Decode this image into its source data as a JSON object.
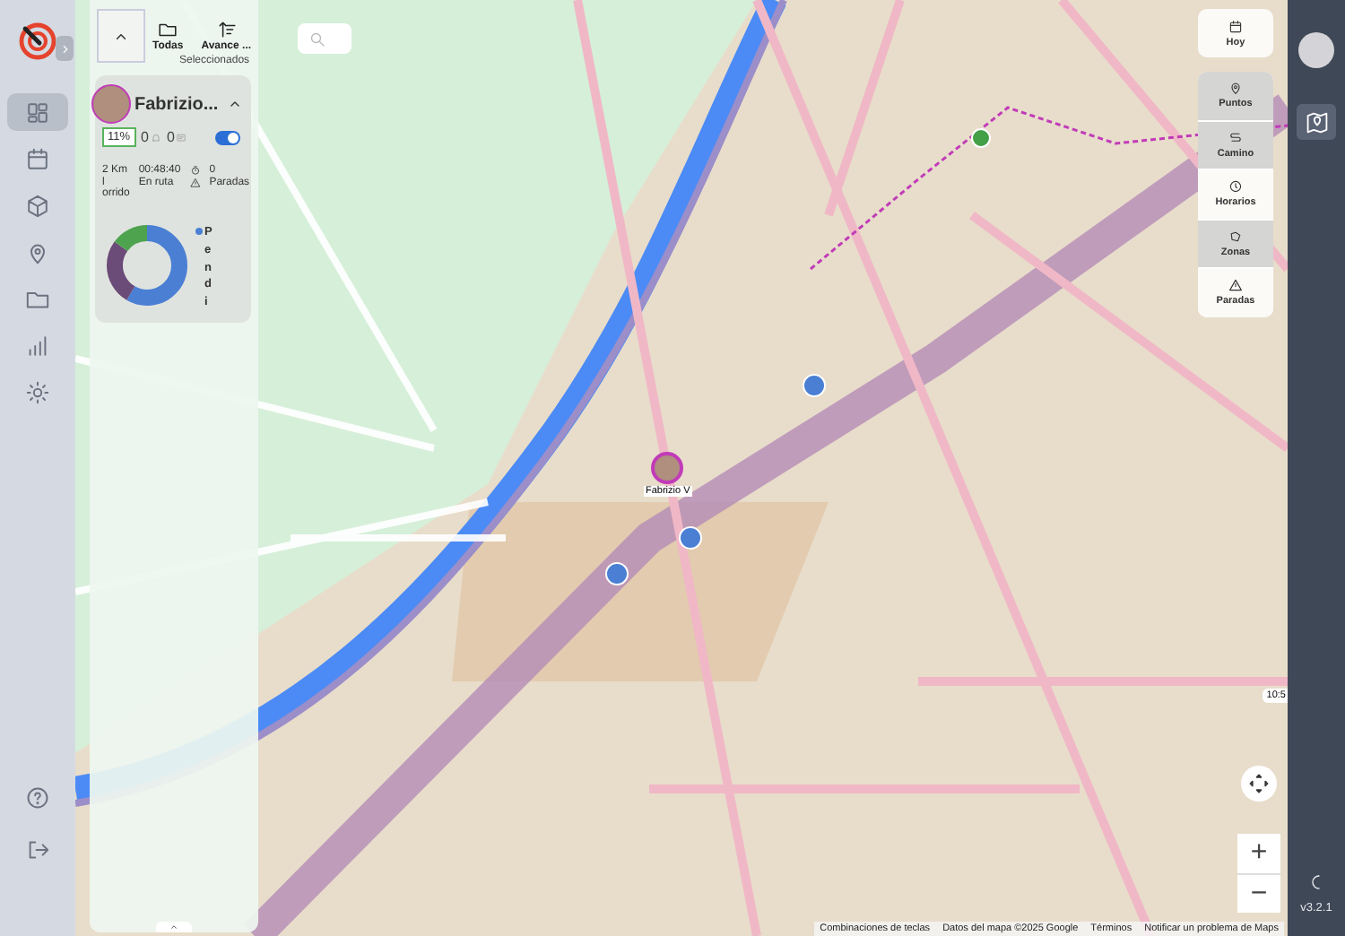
{
  "sidebar": {
    "nav_items": [
      {
        "kind": "dashboard",
        "selected": true
      },
      {
        "kind": "calendar",
        "selected": false
      },
      {
        "kind": "box",
        "selected": false
      },
      {
        "kind": "pin",
        "selected": false
      },
      {
        "kind": "folder",
        "selected": false
      },
      {
        "kind": "chart",
        "selected": false
      },
      {
        "kind": "gear",
        "selected": false
      }
    ],
    "bottom_items": [
      {
        "kind": "help"
      },
      {
        "kind": "logout"
      }
    ]
  },
  "toolbar": {
    "filter_label": "Todas",
    "sort_label": "Avance ...",
    "caption": "Seleccionados"
  },
  "driver_card": {
    "name": "Fabrizio...",
    "expanded": true,
    "progress": "11%",
    "alerts": "0",
    "messages": "0",
    "tracking": true,
    "distance": "2 Km",
    "distance_label": [
      "l",
      "orrido"
    ],
    "time": "00:48:40",
    "time_label": "En ruta",
    "stops": "0",
    "stops_label": "Paradas",
    "legend": [
      {
        "label": "Pendi",
        "color": "#4a7fd4"
      }
    ]
  },
  "map": {
    "marker_label": "Fabrizio V",
    "time_badge": "10:5",
    "zoom_in": "+",
    "zoom_out": "−"
  },
  "today_button": "Hoy",
  "layers": [
    {
      "label": "Puntos",
      "kind": "pin",
      "selected": true
    },
    {
      "label": "Camino",
      "kind": "path",
      "selected": true
    },
    {
      "label": "Horarios",
      "kind": "clock",
      "selected": false
    },
    {
      "label": "Zonas",
      "kind": "zone",
      "selected": true
    },
    {
      "label": "Paradas",
      "kind": "stop",
      "selected": false
    }
  ],
  "attribution": [
    "Combinaciones de teclas",
    "Datos del mapa ©2025 Google",
    "Términos",
    "Notificar un problema de Maps"
  ],
  "version": "v3.2.1"
}
